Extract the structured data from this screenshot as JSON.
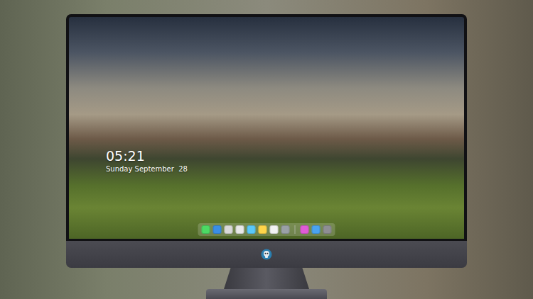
{
  "lock_screen": {
    "time": "05:21",
    "date": "Sunday September  28"
  },
  "dock": {
    "items": [
      {
        "kind": "app",
        "color": "#4cd964"
      },
      {
        "kind": "app",
        "color": "#3a8ee6"
      },
      {
        "kind": "app",
        "color": "#d9d9d9"
      },
      {
        "kind": "app",
        "color": "#e8e8e8"
      },
      {
        "kind": "app",
        "color": "#5ac8fa"
      },
      {
        "kind": "app",
        "color": "#ffd54a"
      },
      {
        "kind": "app",
        "color": "#f2f2f2"
      },
      {
        "kind": "app",
        "color": "#9aa0a6"
      },
      {
        "kind": "separator",
        "color": "#cfcfcf"
      },
      {
        "kind": "app",
        "color": "#e05bd6"
      },
      {
        "kind": "app",
        "color": "#4aa3f0"
      },
      {
        "kind": "app",
        "color": "#8e8e93"
      }
    ]
  }
}
